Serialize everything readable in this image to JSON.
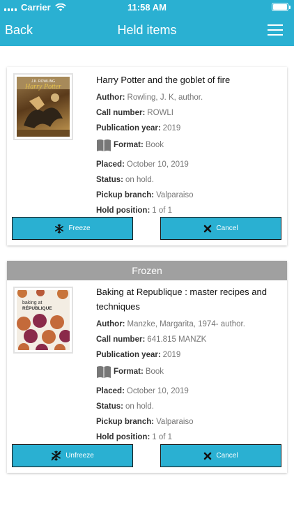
{
  "status_bar": {
    "carrier": "Carrier",
    "time": "11:58 AM"
  },
  "nav": {
    "back_label": "Back",
    "title": "Held items"
  },
  "holds": [
    {
      "title": "Harry Potter and the goblet of fire",
      "author_label": "Author:",
      "author": "Rowling, J. K, author.",
      "call_number_label": "Call number:",
      "call_number": "ROWLI",
      "publication_year_label": "Publication year:",
      "publication_year": "2019",
      "format_label": "Format:",
      "format": "Book",
      "placed_label": "Placed:",
      "placed": "October 10, 2019",
      "status_label": "Status:",
      "status": "on hold.",
      "pickup_branch_label": "Pickup branch:",
      "pickup_branch": "Valparaiso",
      "hold_position_label": "Hold position:",
      "hold_position": "1 of 1",
      "freeze_label": "Freeze",
      "cancel_label": "Cancel",
      "cover_text": "J.K. ROWLING Harry Potter"
    },
    {
      "frozen_banner": "Frozen",
      "title": "Baking at Republique : master recipes and techniques",
      "author_label": "Author:",
      "author": "Manzke, Margarita, 1974- author.",
      "call_number_label": "Call number:",
      "call_number": "641.815 MANZK",
      "publication_year_label": "Publication year:",
      "publication_year": "2019",
      "format_label": "Format:",
      "format": "Book",
      "placed_label": "Placed:",
      "placed": "October 10, 2019",
      "status_label": "Status:",
      "status": "on hold.",
      "pickup_branch_label": "Pickup branch:",
      "pickup_branch": "Valparaiso",
      "hold_position_label": "Hold position:",
      "hold_position": "1 of 1",
      "unfreeze_label": "Unfreeze",
      "cancel_label": "Cancel",
      "cover_text_1": "baking at",
      "cover_text_2": "RÉPUBLIQUE"
    }
  ],
  "colors": {
    "accent": "#2ab0d2",
    "frozen_bar": "#a0a0a0"
  },
  "icons": [
    "wifi-icon",
    "battery-icon",
    "menu-icon",
    "book-icon",
    "snowflake-icon",
    "unfreeze-icon",
    "close-icon"
  ]
}
